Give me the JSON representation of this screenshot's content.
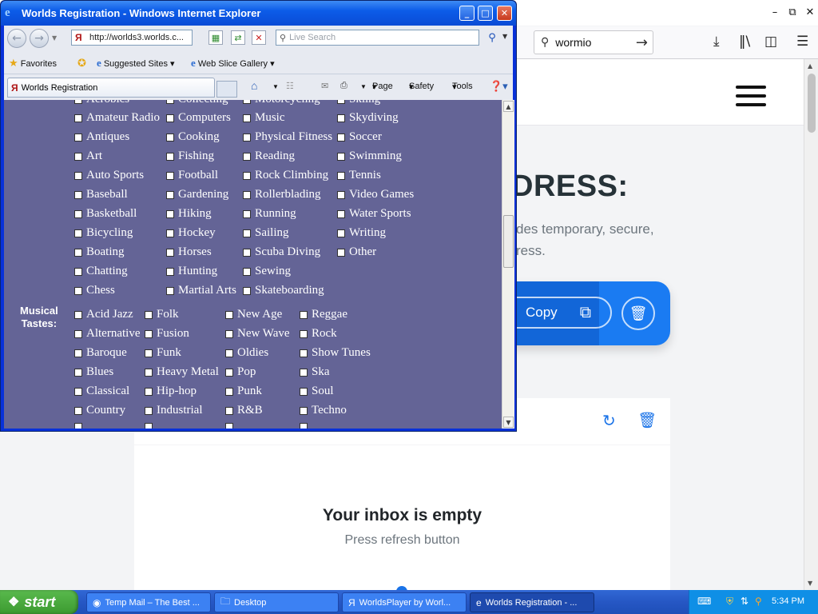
{
  "background_browser": {
    "search_value": "wormio",
    "heading": "DRESS:",
    "desc_line1": "des temporary, secure,",
    "desc_line2": "ress.",
    "copy_label": "Copy",
    "inbox_empty": "Your inbox is empty",
    "inbox_hint": "Press refresh button"
  },
  "ie": {
    "title": "Worlds Registration - Windows Internet Explorer",
    "address": "http://worlds3.worlds.c...",
    "search_placeholder": "Live Search",
    "favorites": "Favorites",
    "suggested_sites": "Suggested Sites",
    "web_slice_gallery": "Web Slice Gallery",
    "tab_label": "Worlds Registration",
    "cmd": {
      "page": "Page",
      "safety": "Safety",
      "tools": "Tools"
    }
  },
  "hobbies": {
    "partial_top": [
      "Aerobics",
      "Collecting",
      "Motorcycling",
      "Skiing"
    ],
    "col1": [
      "Amateur Radio",
      "Antiques",
      "Art",
      "Auto Sports",
      "Baseball",
      "Basketball",
      "Bicycling",
      "Boating",
      "Chatting",
      "Chess"
    ],
    "col2": [
      "Computers",
      "Cooking",
      "Fishing",
      "Football",
      "Gardening",
      "Hiking",
      "Hockey",
      "Horses",
      "Hunting",
      "Martial Arts"
    ],
    "col3": [
      "Music",
      "Physical Fitness",
      "Reading",
      "Rock Climbing",
      "Rollerblading",
      "Running",
      "Sailing",
      "Scuba Diving",
      "Sewing",
      "Skateboarding"
    ],
    "col4": [
      "Skydiving",
      "Soccer",
      "Swimming",
      "Tennis",
      "Video Games",
      "Water Sports",
      "Writing",
      "Other"
    ]
  },
  "music": {
    "label_line1": "Musical",
    "label_line2": "Tastes:",
    "col1": [
      "Acid Jazz",
      "Alternative",
      "Baroque",
      "Blues",
      "Classical",
      "Country"
    ],
    "col2": [
      "Folk",
      "Fusion",
      "Funk",
      "Heavy Metal",
      "Hip-hop",
      "Industrial"
    ],
    "col3": [
      "New Age",
      "New Wave",
      "Oldies",
      "Pop",
      "Punk",
      "R&B"
    ],
    "col4": [
      "Reggae",
      "Rock",
      "Show Tunes",
      "Ska",
      "Soul",
      "Techno"
    ]
  },
  "taskbar": {
    "start": "start",
    "tasks": [
      "Temp Mail – The Best ...",
      "Desktop",
      "WorldsPlayer by Worl...",
      "Worlds Registration - ..."
    ],
    "clock": "5:34 PM"
  },
  "colors": {
    "ie_content_bg": "#646496",
    "accent_blue": "#1a7bf2",
    "xp_taskbar": "#2657c4"
  }
}
